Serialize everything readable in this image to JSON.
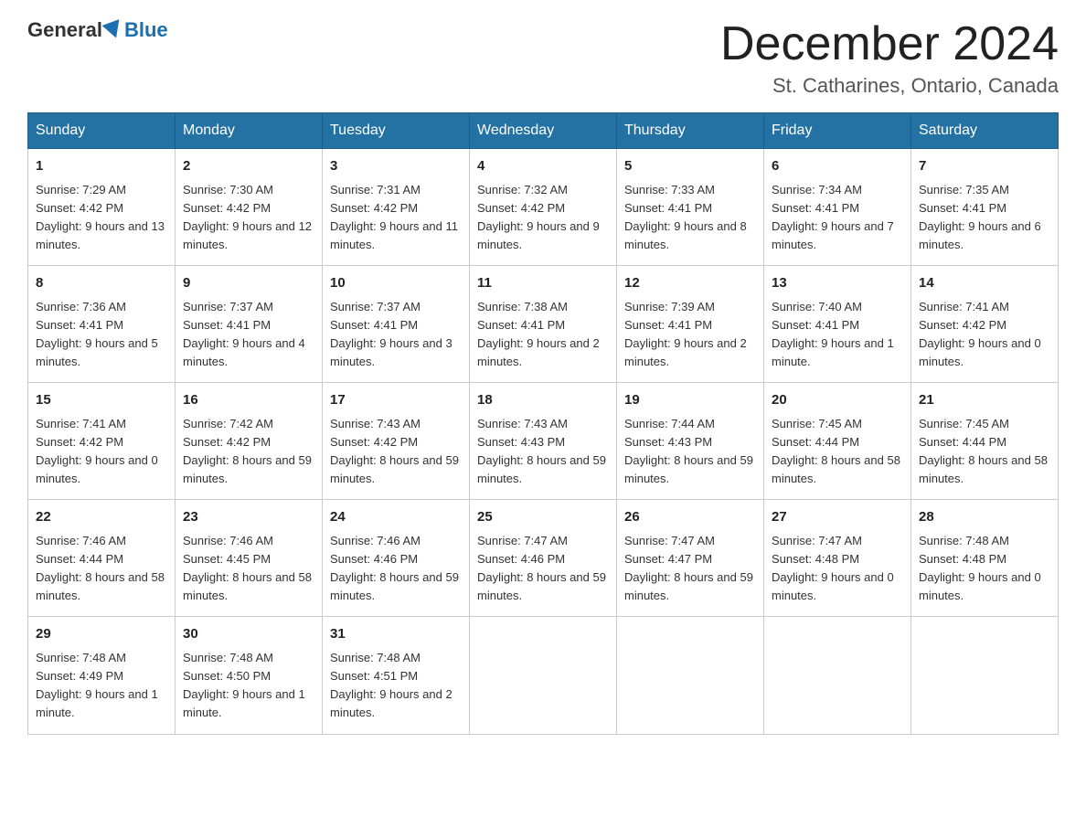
{
  "header": {
    "logo_general": "General",
    "logo_blue": "Blue",
    "month_title": "December 2024",
    "location": "St. Catharines, Ontario, Canada"
  },
  "weekdays": [
    "Sunday",
    "Monday",
    "Tuesday",
    "Wednesday",
    "Thursday",
    "Friday",
    "Saturday"
  ],
  "weeks": [
    [
      {
        "day": "1",
        "sunrise": "Sunrise: 7:29 AM",
        "sunset": "Sunset: 4:42 PM",
        "daylight": "Daylight: 9 hours and 13 minutes."
      },
      {
        "day": "2",
        "sunrise": "Sunrise: 7:30 AM",
        "sunset": "Sunset: 4:42 PM",
        "daylight": "Daylight: 9 hours and 12 minutes."
      },
      {
        "day": "3",
        "sunrise": "Sunrise: 7:31 AM",
        "sunset": "Sunset: 4:42 PM",
        "daylight": "Daylight: 9 hours and 11 minutes."
      },
      {
        "day": "4",
        "sunrise": "Sunrise: 7:32 AM",
        "sunset": "Sunset: 4:42 PM",
        "daylight": "Daylight: 9 hours and 9 minutes."
      },
      {
        "day": "5",
        "sunrise": "Sunrise: 7:33 AM",
        "sunset": "Sunset: 4:41 PM",
        "daylight": "Daylight: 9 hours and 8 minutes."
      },
      {
        "day": "6",
        "sunrise": "Sunrise: 7:34 AM",
        "sunset": "Sunset: 4:41 PM",
        "daylight": "Daylight: 9 hours and 7 minutes."
      },
      {
        "day": "7",
        "sunrise": "Sunrise: 7:35 AM",
        "sunset": "Sunset: 4:41 PM",
        "daylight": "Daylight: 9 hours and 6 minutes."
      }
    ],
    [
      {
        "day": "8",
        "sunrise": "Sunrise: 7:36 AM",
        "sunset": "Sunset: 4:41 PM",
        "daylight": "Daylight: 9 hours and 5 minutes."
      },
      {
        "day": "9",
        "sunrise": "Sunrise: 7:37 AM",
        "sunset": "Sunset: 4:41 PM",
        "daylight": "Daylight: 9 hours and 4 minutes."
      },
      {
        "day": "10",
        "sunrise": "Sunrise: 7:37 AM",
        "sunset": "Sunset: 4:41 PM",
        "daylight": "Daylight: 9 hours and 3 minutes."
      },
      {
        "day": "11",
        "sunrise": "Sunrise: 7:38 AM",
        "sunset": "Sunset: 4:41 PM",
        "daylight": "Daylight: 9 hours and 2 minutes."
      },
      {
        "day": "12",
        "sunrise": "Sunrise: 7:39 AM",
        "sunset": "Sunset: 4:41 PM",
        "daylight": "Daylight: 9 hours and 2 minutes."
      },
      {
        "day": "13",
        "sunrise": "Sunrise: 7:40 AM",
        "sunset": "Sunset: 4:41 PM",
        "daylight": "Daylight: 9 hours and 1 minute."
      },
      {
        "day": "14",
        "sunrise": "Sunrise: 7:41 AM",
        "sunset": "Sunset: 4:42 PM",
        "daylight": "Daylight: 9 hours and 0 minutes."
      }
    ],
    [
      {
        "day": "15",
        "sunrise": "Sunrise: 7:41 AM",
        "sunset": "Sunset: 4:42 PM",
        "daylight": "Daylight: 9 hours and 0 minutes."
      },
      {
        "day": "16",
        "sunrise": "Sunrise: 7:42 AM",
        "sunset": "Sunset: 4:42 PM",
        "daylight": "Daylight: 8 hours and 59 minutes."
      },
      {
        "day": "17",
        "sunrise": "Sunrise: 7:43 AM",
        "sunset": "Sunset: 4:42 PM",
        "daylight": "Daylight: 8 hours and 59 minutes."
      },
      {
        "day": "18",
        "sunrise": "Sunrise: 7:43 AM",
        "sunset": "Sunset: 4:43 PM",
        "daylight": "Daylight: 8 hours and 59 minutes."
      },
      {
        "day": "19",
        "sunrise": "Sunrise: 7:44 AM",
        "sunset": "Sunset: 4:43 PM",
        "daylight": "Daylight: 8 hours and 59 minutes."
      },
      {
        "day": "20",
        "sunrise": "Sunrise: 7:45 AM",
        "sunset": "Sunset: 4:44 PM",
        "daylight": "Daylight: 8 hours and 58 minutes."
      },
      {
        "day": "21",
        "sunrise": "Sunrise: 7:45 AM",
        "sunset": "Sunset: 4:44 PM",
        "daylight": "Daylight: 8 hours and 58 minutes."
      }
    ],
    [
      {
        "day": "22",
        "sunrise": "Sunrise: 7:46 AM",
        "sunset": "Sunset: 4:44 PM",
        "daylight": "Daylight: 8 hours and 58 minutes."
      },
      {
        "day": "23",
        "sunrise": "Sunrise: 7:46 AM",
        "sunset": "Sunset: 4:45 PM",
        "daylight": "Daylight: 8 hours and 58 minutes."
      },
      {
        "day": "24",
        "sunrise": "Sunrise: 7:46 AM",
        "sunset": "Sunset: 4:46 PM",
        "daylight": "Daylight: 8 hours and 59 minutes."
      },
      {
        "day": "25",
        "sunrise": "Sunrise: 7:47 AM",
        "sunset": "Sunset: 4:46 PM",
        "daylight": "Daylight: 8 hours and 59 minutes."
      },
      {
        "day": "26",
        "sunrise": "Sunrise: 7:47 AM",
        "sunset": "Sunset: 4:47 PM",
        "daylight": "Daylight: 8 hours and 59 minutes."
      },
      {
        "day": "27",
        "sunrise": "Sunrise: 7:47 AM",
        "sunset": "Sunset: 4:48 PM",
        "daylight": "Daylight: 9 hours and 0 minutes."
      },
      {
        "day": "28",
        "sunrise": "Sunrise: 7:48 AM",
        "sunset": "Sunset: 4:48 PM",
        "daylight": "Daylight: 9 hours and 0 minutes."
      }
    ],
    [
      {
        "day": "29",
        "sunrise": "Sunrise: 7:48 AM",
        "sunset": "Sunset: 4:49 PM",
        "daylight": "Daylight: 9 hours and 1 minute."
      },
      {
        "day": "30",
        "sunrise": "Sunrise: 7:48 AM",
        "sunset": "Sunset: 4:50 PM",
        "daylight": "Daylight: 9 hours and 1 minute."
      },
      {
        "day": "31",
        "sunrise": "Sunrise: 7:48 AM",
        "sunset": "Sunset: 4:51 PM",
        "daylight": "Daylight: 9 hours and 2 minutes."
      },
      null,
      null,
      null,
      null
    ]
  ]
}
